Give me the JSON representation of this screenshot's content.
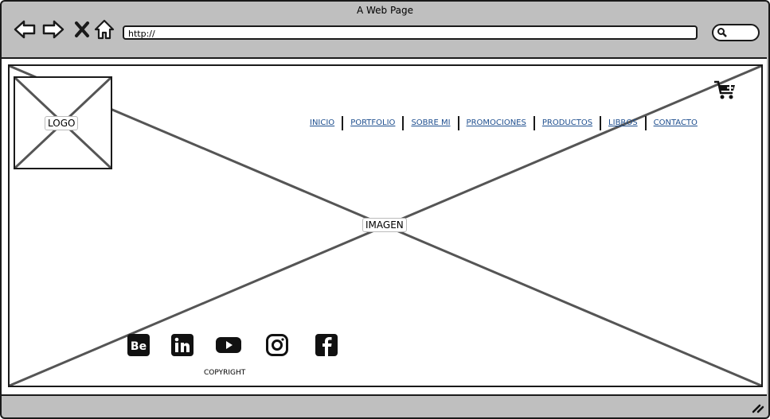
{
  "window": {
    "title": "A Web Page"
  },
  "toolbar": {
    "url": "http://"
  },
  "page": {
    "logo_label": "LOGO",
    "image_label": "IMAGEN",
    "nav": [
      "INICIO",
      "PORTFOLIO",
      "SOBRE MI",
      "PROMOCIONES",
      "PRODUCTOS",
      "LIBROS",
      "CONTACTO"
    ],
    "footer": {
      "social": [
        "behance-icon",
        "linkedin-icon",
        "youtube-icon",
        "instagram-icon",
        "facebook-icon"
      ],
      "copyright": "COPYRIGHT"
    }
  },
  "colors": {
    "chrome": "#bfbfbf",
    "link": "#1f4f8f",
    "stroke": "#1a1a1a"
  }
}
